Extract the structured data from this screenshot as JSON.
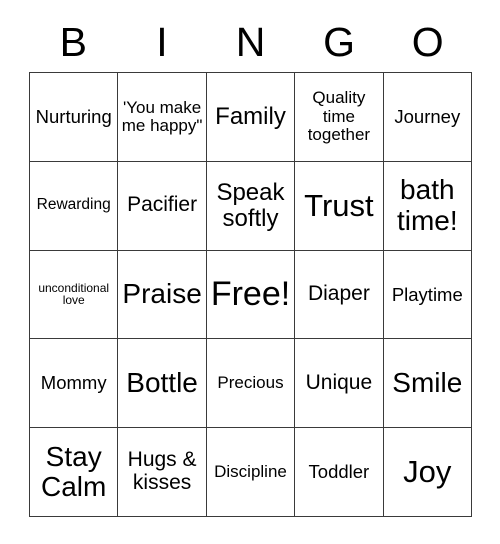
{
  "card": {
    "title": "BINGO",
    "header": [
      {
        "letter": "B"
      },
      {
        "letter": "I"
      },
      {
        "letter": "N"
      },
      {
        "letter": "G"
      },
      {
        "letter": "O"
      }
    ],
    "rows": [
      [
        {
          "text": "Nurturing",
          "size": "fs-m"
        },
        {
          "text": "'You make me happy\"",
          "size": "fs-sm"
        },
        {
          "text": "Family",
          "size": "fs-l"
        },
        {
          "text": "Quality time together",
          "size": "fs-sm"
        },
        {
          "text": "Journey",
          "size": "fs-m"
        }
      ],
      [
        {
          "text": "Rewarding",
          "size": "fs-s"
        },
        {
          "text": "Pacifier",
          "size": "fs-ml"
        },
        {
          "text": "Speak softly",
          "size": "fs-l"
        },
        {
          "text": "Trust",
          "size": "fs-xxl"
        },
        {
          "text": "bath time!",
          "size": "fs-xl"
        }
      ],
      [
        {
          "text": "unconditional love",
          "size": "fs-xs"
        },
        {
          "text": "Praise",
          "size": "fs-xl"
        },
        {
          "text": "Free!",
          "size": "fs-huge"
        },
        {
          "text": "Diaper",
          "size": "fs-ml"
        },
        {
          "text": "Playtime",
          "size": "fs-m"
        }
      ],
      [
        {
          "text": "Mommy",
          "size": "fs-m"
        },
        {
          "text": "Bottle",
          "size": "fs-xl"
        },
        {
          "text": "Precious",
          "size": "fs-sm"
        },
        {
          "text": "Unique",
          "size": "fs-ml"
        },
        {
          "text": "Smile",
          "size": "fs-xl"
        }
      ],
      [
        {
          "text": "Stay Calm",
          "size": "fs-xl"
        },
        {
          "text": "Hugs & kisses",
          "size": "fs-ml"
        },
        {
          "text": "Discipline",
          "size": "fs-sm"
        },
        {
          "text": "Toddler",
          "size": "fs-m"
        },
        {
          "text": "Joy",
          "size": "fs-xxl"
        }
      ]
    ],
    "colors": {
      "background": "#ffffff",
      "text": "#000000",
      "border": "#3a3a3a"
    }
  }
}
